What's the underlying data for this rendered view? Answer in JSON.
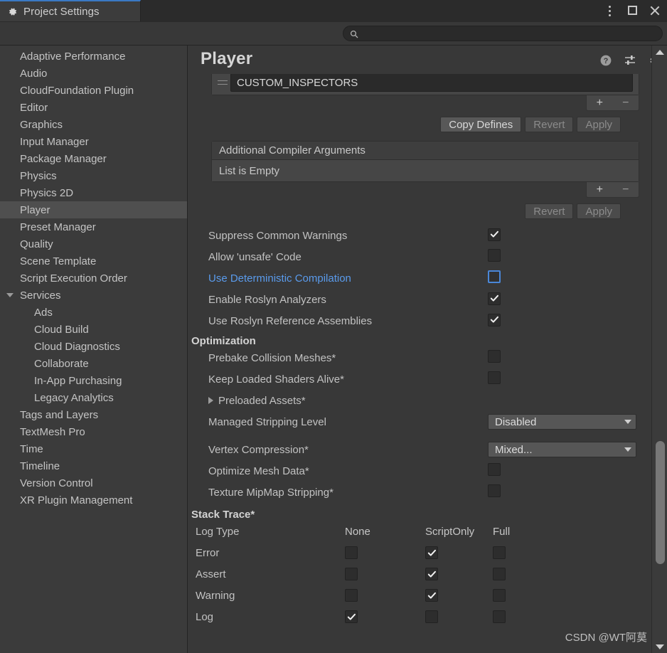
{
  "window": {
    "tab_title": "Project Settings",
    "tab_icon": "gear-icon",
    "controls": {
      "menu": "more-options-icon",
      "maximize": "maximize-icon",
      "close": "close-icon"
    }
  },
  "search": {
    "icon": "search-icon",
    "value": "",
    "placeholder": ""
  },
  "sidebar": {
    "items": [
      {
        "label": "Adaptive Performance",
        "level": 0,
        "selected": false,
        "expandable": false
      },
      {
        "label": "Audio",
        "level": 0,
        "selected": false,
        "expandable": false
      },
      {
        "label": "CloudFoundation Plugin",
        "level": 0,
        "selected": false,
        "expandable": false
      },
      {
        "label": "Editor",
        "level": 0,
        "selected": false,
        "expandable": false
      },
      {
        "label": "Graphics",
        "level": 0,
        "selected": false,
        "expandable": false
      },
      {
        "label": "Input Manager",
        "level": 0,
        "selected": false,
        "expandable": false
      },
      {
        "label": "Package Manager",
        "level": 0,
        "selected": false,
        "expandable": false
      },
      {
        "label": "Physics",
        "level": 0,
        "selected": false,
        "expandable": false
      },
      {
        "label": "Physics 2D",
        "level": 0,
        "selected": false,
        "expandable": false
      },
      {
        "label": "Player",
        "level": 0,
        "selected": true,
        "expandable": false
      },
      {
        "label": "Preset Manager",
        "level": 0,
        "selected": false,
        "expandable": false
      },
      {
        "label": "Quality",
        "level": 0,
        "selected": false,
        "expandable": false
      },
      {
        "label": "Scene Template",
        "level": 0,
        "selected": false,
        "expandable": false
      },
      {
        "label": "Script Execution Order",
        "level": 0,
        "selected": false,
        "expandable": false
      },
      {
        "label": "Services",
        "level": 0,
        "selected": false,
        "expandable": true,
        "expanded": true
      },
      {
        "label": "Ads",
        "level": 1,
        "selected": false,
        "expandable": false
      },
      {
        "label": "Cloud Build",
        "level": 1,
        "selected": false,
        "expandable": false
      },
      {
        "label": "Cloud Diagnostics",
        "level": 1,
        "selected": false,
        "expandable": false
      },
      {
        "label": "Collaborate",
        "level": 1,
        "selected": false,
        "expandable": false
      },
      {
        "label": "In-App Purchasing",
        "level": 1,
        "selected": false,
        "expandable": false
      },
      {
        "label": "Legacy Analytics",
        "level": 1,
        "selected": false,
        "expandable": false
      },
      {
        "label": "Tags and Layers",
        "level": 0,
        "selected": false,
        "expandable": false
      },
      {
        "label": "TextMesh Pro",
        "level": 0,
        "selected": false,
        "expandable": false
      },
      {
        "label": "Time",
        "level": 0,
        "selected": false,
        "expandable": false
      },
      {
        "label": "Timeline",
        "level": 0,
        "selected": false,
        "expandable": false
      },
      {
        "label": "Version Control",
        "level": 0,
        "selected": false,
        "expandable": false
      },
      {
        "label": "XR Plugin Management",
        "level": 0,
        "selected": false,
        "expandable": false
      }
    ]
  },
  "panel": {
    "title": "Player",
    "header_icons": [
      "help-icon",
      "preset-icon",
      "gear-icon"
    ],
    "defines_list": {
      "item_value": "CUSTOM_INSPECTORS",
      "add_label": "+",
      "remove_label": "−",
      "buttons": [
        {
          "label": "Copy Defines",
          "disabled": false
        },
        {
          "label": "Revert",
          "disabled": true
        },
        {
          "label": "Apply",
          "disabled": true
        }
      ]
    },
    "compiler_args_list": {
      "header": "Additional Compiler Arguments",
      "empty_text": "List is Empty",
      "add_label": "+",
      "remove_label": "−",
      "buttons": [
        {
          "label": "Revert",
          "disabled": true
        },
        {
          "label": "Apply",
          "disabled": true
        }
      ]
    },
    "toggles": [
      {
        "label": "Suppress Common Warnings",
        "checked": true,
        "highlighted": false
      },
      {
        "label": "Allow 'unsafe' Code",
        "checked": false,
        "highlighted": false
      },
      {
        "label": "Use Deterministic Compilation",
        "checked": false,
        "highlighted": true
      },
      {
        "label": "Enable Roslyn Analyzers",
        "checked": true,
        "highlighted": false
      },
      {
        "label": "Use Roslyn Reference Assemblies",
        "checked": true,
        "highlighted": false
      }
    ],
    "optimization": {
      "header": "Optimization",
      "toggles": [
        {
          "label": "Prebake Collision Meshes*",
          "checked": false
        },
        {
          "label": "Keep Loaded Shaders Alive*",
          "checked": false
        }
      ],
      "foldout": {
        "label": "Preloaded Assets*",
        "expanded": false
      },
      "dropdowns": [
        {
          "label": "Managed Stripping Level",
          "value": "Disabled"
        },
        {
          "label": "Vertex Compression*",
          "value": "Mixed..."
        }
      ],
      "toggles2": [
        {
          "label": "Optimize Mesh Data*",
          "checked": false
        },
        {
          "label": "Texture MipMap Stripping*",
          "checked": false
        }
      ]
    },
    "stack_trace": {
      "header": "Stack Trace*",
      "columns": [
        "Log Type",
        "None",
        "ScriptOnly",
        "Full"
      ],
      "rows": [
        {
          "log_type": "Error",
          "none": false,
          "script_only": true,
          "full": false
        },
        {
          "log_type": "Assert",
          "none": false,
          "script_only": true,
          "full": false
        },
        {
          "log_type": "Warning",
          "none": false,
          "script_only": true,
          "full": false
        },
        {
          "log_type": "Log",
          "none": true,
          "script_only": false,
          "full": false
        }
      ]
    }
  },
  "watermark": "CSDN @WT阿莫",
  "colors": {
    "background": "#383838",
    "sidebar": "#3b3b3b",
    "selection": "#4f4f4f",
    "accent_blue": "#5a9bec",
    "tab_accent": "#3a79c4",
    "text": "#c2c2c2"
  }
}
